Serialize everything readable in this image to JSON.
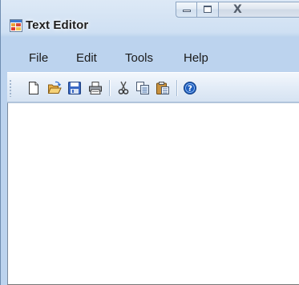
{
  "window": {
    "title": "Text Editor",
    "icon": "application-window-icon"
  },
  "caption_buttons": [
    {
      "name": "minimize",
      "icon": "minimize-icon"
    },
    {
      "name": "maximize",
      "icon": "maximize-icon"
    },
    {
      "name": "close",
      "icon": "close-icon",
      "glyph": "X"
    }
  ],
  "menu": {
    "items": [
      {
        "label": "File"
      },
      {
        "label": "Edit"
      },
      {
        "label": "Tools"
      },
      {
        "label": "Help"
      }
    ]
  },
  "toolbar": {
    "buttons": [
      {
        "icon": "new-document-icon"
      },
      {
        "icon": "open-folder-icon"
      },
      {
        "icon": "save-disk-icon"
      },
      {
        "icon": "print-icon"
      },
      {
        "icon": "cut-scissors-icon"
      },
      {
        "icon": "copy-icon"
      },
      {
        "icon": "paste-icon"
      },
      {
        "icon": "help-icon"
      }
    ]
  },
  "editor": {
    "content": ""
  },
  "colors": {
    "chrome": "#cfe0f3",
    "toolbar": "#e3ecf7",
    "editor_background": "#ffffff",
    "help_icon": "#1f5fbf"
  }
}
